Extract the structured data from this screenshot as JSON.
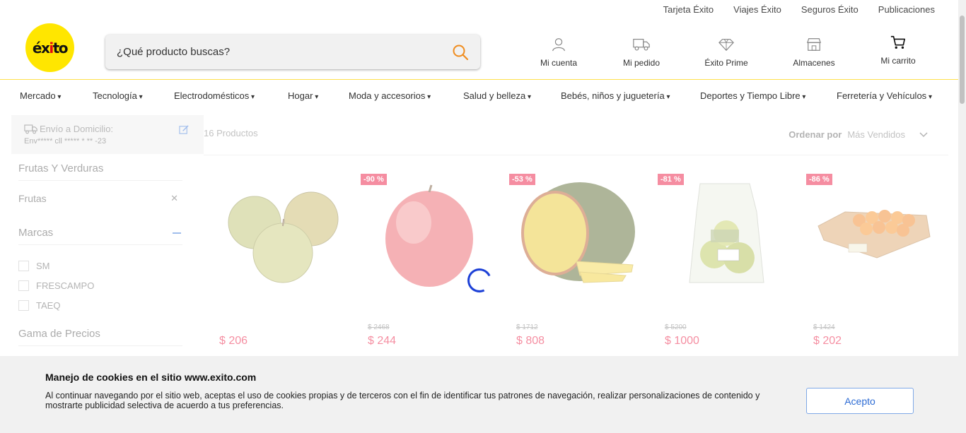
{
  "top_links": [
    "Tarjeta Éxito",
    "Viajes Éxito",
    "Seguros Éxito",
    "Publicaciones"
  ],
  "logo": {
    "text_main": "éx",
    "text_dot": "i",
    "text_end": "to",
    "bg_color": "#ffe600"
  },
  "search": {
    "placeholder": "¿Qué producto buscas?",
    "icon": "search-icon"
  },
  "header_items": [
    {
      "label": "Mi cuenta",
      "icon": "user-icon"
    },
    {
      "label": "Mi pedido",
      "icon": "truck-icon"
    },
    {
      "label": "Éxito Prime",
      "icon": "diamond-icon"
    },
    {
      "label": "Almacenes",
      "icon": "store-icon"
    },
    {
      "label": "Mi carrito",
      "icon": "cart-icon"
    }
  ],
  "categories": [
    "Mercado",
    "Tecnología",
    "Electrodomésticos",
    "Hogar",
    "Moda y accesorios",
    "Salud y belleza",
    "Bebés, niños y juguetería",
    "Deportes y Tiempo Libre",
    "Ferretería y Vehículos"
  ],
  "delivery": {
    "label": "Envío a Domicilio:",
    "address": "Env***** cll ***** * ** -23"
  },
  "filters": {
    "category_title": "Frutas Y Verduras",
    "active_filter": "Frutas",
    "brands_title": "Marcas",
    "brands": [
      "SM",
      "FRESCAMPO",
      "TAEQ"
    ],
    "price_title": "Gama de Precios"
  },
  "results": {
    "count": "16 Productos",
    "sort_label": "Ordenar por",
    "sort_value": "Más Vendidos"
  },
  "products": [
    {
      "name": "apple-green",
      "badge": "",
      "old_price": "",
      "price": "$ 206"
    },
    {
      "name": "apple-red",
      "badge": "-90 %",
      "old_price": "$ 2468",
      "price": "$ 244"
    },
    {
      "name": "mango",
      "badge": "-53 %",
      "old_price": "$ 1712",
      "price": "$ 808"
    },
    {
      "name": "pear-bag",
      "badge": "-81 %",
      "old_price": "$ 5200",
      "price": "$ 1000"
    },
    {
      "name": "mandarin-tray",
      "badge": "-86 %",
      "old_price": "$ 1424",
      "price": "$ 202"
    }
  ],
  "cookie": {
    "title": "Manejo de cookies en el sitio www.exito.com",
    "text": "Al continuar navegando por el sitio web, aceptas el uso de cookies propias y de terceros con el fin de identificar tus patrones de navegación, realizar personalizaciones de contenido y mostrarte publicidad selectiva de acuerdo a tus preferencias.",
    "accept_label": "Acepto"
  },
  "colors": {
    "brand_yellow": "#ffe600",
    "discount_red": "#e8002d",
    "spinner_blue": "#1a3ed6",
    "accept_blue": "#2c6bd4"
  }
}
